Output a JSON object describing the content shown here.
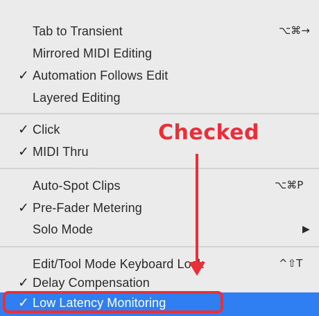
{
  "menu": {
    "items": [
      {
        "label": "Tab to Transient",
        "checked": false,
        "shortcut": "⌥⌘→"
      },
      {
        "label": "Mirrored MIDI Editing",
        "checked": false
      },
      {
        "label": "Automation Follows Edit",
        "checked": true
      },
      {
        "label": "Layered Editing",
        "checked": false
      },
      {
        "label": "Click",
        "checked": true
      },
      {
        "label": "MIDI Thru",
        "checked": true
      },
      {
        "label": "Auto-Spot Clips",
        "checked": false,
        "shortcut": "⌥⌘P"
      },
      {
        "label": "Pre-Fader Metering",
        "checked": true
      },
      {
        "label": "Solo Mode",
        "checked": false,
        "submenu": true
      },
      {
        "label": "Edit/Tool Mode Keyboard Lock",
        "checked": false,
        "shortcut": "^⇧T"
      },
      {
        "label": "Delay Compensation",
        "checked": true
      },
      {
        "label": "Low Latency Monitoring",
        "checked": true,
        "highlighted": true
      }
    ],
    "check_glyph": "✓",
    "submenu_glyph": "▶"
  },
  "annotation": {
    "label": "Checked",
    "color": "#e8303a"
  },
  "colors": {
    "menu_background": "#ebebeb",
    "highlight": "#2f7ff2",
    "annotation": "#e8303a"
  }
}
